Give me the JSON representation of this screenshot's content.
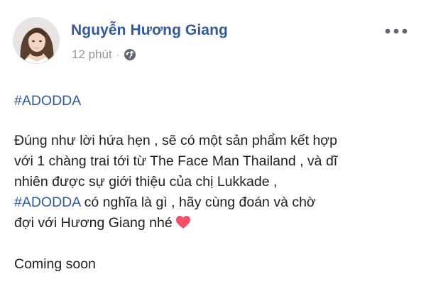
{
  "post": {
    "author": "Nguyễn Hương Giang",
    "time": "12 phút",
    "separator": "·",
    "privacy_icon": "globe-icon",
    "more_icon": "more-horizontal-icon",
    "avatar_icon": "profile-avatar",
    "hashtag_line": "#ADODDA",
    "body_lines": {
      "l1": "Đúng như lời hứa hẹn , sẽ có một sản phẩm kết hợp",
      "l2": "với 1 chàng trai tới từ The Face Man Thailand , và dĩ",
      "l3": "nhiên được sự giới thiệu của chị Lukkade ,",
      "l4_hashtag": "#ADODDA",
      "l4_rest": " có nghĩa là gì , hãy cùng đoán và chờ",
      "l5": "đợi với Hương Giang nhé"
    },
    "heart_icon": "heart-icon",
    "closing": "Coming soon"
  },
  "colors": {
    "link": "#365899",
    "meta": "#90949c",
    "text": "#1c1e21",
    "heart": "#f25268"
  }
}
